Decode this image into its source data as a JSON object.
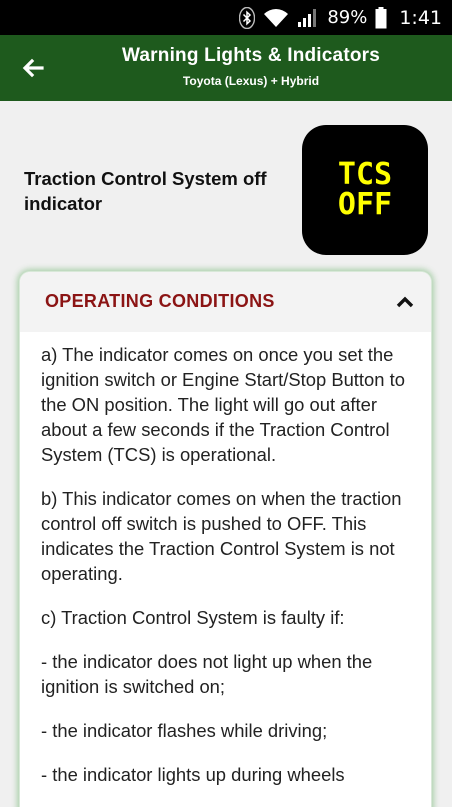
{
  "status_bar": {
    "battery": "89%",
    "time": "1:41",
    "icons": [
      "bluetooth-icon",
      "wifi-icon",
      "signal-icon",
      "battery-icon"
    ]
  },
  "header": {
    "title": "Warning Lights & Indicators",
    "subtitle": "Toyota (Lexus) + Hybrid",
    "back_icon": "back-arrow-icon",
    "color": "#1e5a1d"
  },
  "indicator": {
    "title": "Traction Control System off indicator",
    "symbol_line1": "TCS",
    "symbol_line2": "OFF",
    "symbol_color": "#ffff00"
  },
  "section": {
    "title": "OPERATING CONDITIONS",
    "title_color": "#8b1414",
    "expanded": true,
    "toggle_icon": "chevron-up-icon",
    "paragraphs": [
      "a) The indicator comes on once you set the ignition switch or Engine Start/Stop Button to the ON position. The light will go out after about a few seconds if the Traction Control System (TCS) is operational.",
      "b) This indicator comes on when the traction control off switch is pushed to OFF. This indicates the Traction Control System is not operating.",
      "c) Traction Control System is faulty if:",
      "- the indicator does not light up when the ignition is switched on;",
      "- the indicator flashes while driving;",
      "- the indicator lights up during wheels"
    ]
  }
}
